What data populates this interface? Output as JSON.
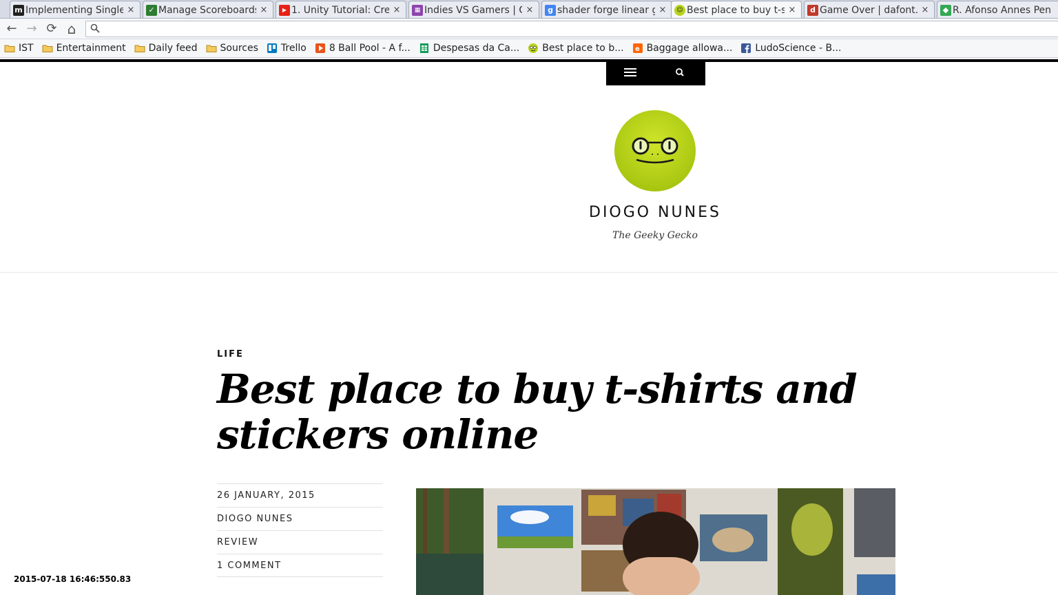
{
  "browser": {
    "tabs": [
      {
        "title": "Implementing Single",
        "icon": "medium-icon",
        "color": "#222222",
        "active": false
      },
      {
        "title": "Manage Scoreboards",
        "icon": "scoreboard-icon",
        "color": "#2e7d32",
        "active": false
      },
      {
        "title": "1. Unity Tutorial: Cre",
        "icon": "youtube-icon",
        "color": "#e62117",
        "active": false
      },
      {
        "title": "Indies VS Gamers | G",
        "icon": "indies-icon",
        "color": "#8e44ad",
        "active": false
      },
      {
        "title": "shader forge linear g",
        "icon": "google-icon",
        "color": "#4285f4",
        "active": false
      },
      {
        "title": "Best place to buy t-sh",
        "icon": "gecko-icon",
        "color": "#b8d31a",
        "active": true
      },
      {
        "title": "Game Over | dafont.c",
        "icon": "dafont-icon",
        "color": "#c0392b",
        "active": false
      },
      {
        "title": "R. Afonso Annes Pen",
        "icon": "maps-icon",
        "color": "#34a853",
        "active": false
      }
    ],
    "close_glyph": "×",
    "toolbar": {
      "back": "←",
      "forward": "→",
      "reload": "⟳",
      "home": "⌂"
    },
    "omnibox": {
      "value": ""
    },
    "bookmarks": [
      {
        "label": "IST",
        "icon": "folder-icon"
      },
      {
        "label": "Entertainment",
        "icon": "folder-icon"
      },
      {
        "label": "Daily feed",
        "icon": "folder-icon"
      },
      {
        "label": "Sources",
        "icon": "folder-icon"
      },
      {
        "label": "Trello",
        "icon": "trello-icon"
      },
      {
        "label": "8 Ball Pool - A f...",
        "icon": "play-icon"
      },
      {
        "label": "Despesas da Ca...",
        "icon": "sheets-icon"
      },
      {
        "label": "Best place to b...",
        "icon": "gecko-icon"
      },
      {
        "label": "Baggage allowa...",
        "icon": "easyjet-icon"
      },
      {
        "label": "LudoScience - B...",
        "icon": "facebook-icon"
      }
    ]
  },
  "site": {
    "title": "DIOGO NUNES",
    "tagline": "The Geeky Gecko",
    "logo_color": "#b8d31a"
  },
  "post": {
    "category": "LIFE",
    "title": "Best place to buy t-shirts and stickers online",
    "meta": [
      {
        "label": "26 JANUARY, 2015"
      },
      {
        "label": "DIOGO NUNES"
      },
      {
        "label": "REVIEW"
      },
      {
        "label": "1 COMMENT"
      }
    ]
  },
  "overlay": {
    "timestamp": "2015-07-18 16:46:550.83"
  }
}
